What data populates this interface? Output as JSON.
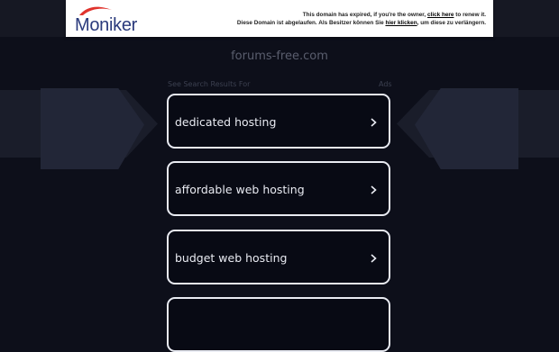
{
  "banner": {
    "logo_text": "Moniker",
    "line1_prefix": "This domain has expired, if you're the owner, ",
    "line1_link": "click here",
    "line1_suffix": " to renew it.",
    "line2_prefix": "Diese Domain ist abgelaufen. Als Besitzer können Sie ",
    "line2_link": "hier klicken",
    "line2_suffix": ", um diese zu verlängern."
  },
  "domain": "forums-free.com",
  "search_label": "See Search Results For",
  "ads_label": "Ads",
  "results": [
    {
      "label": "dedicated hosting"
    },
    {
      "label": "affordable web hosting"
    },
    {
      "label": "budget web hosting"
    },
    {
      "label": ""
    }
  ],
  "colors": {
    "background": "#0d0f1a",
    "card_border": "#e9ebf2",
    "logo_blue": "#2a3a7c",
    "logo_red": "#e0332d"
  },
  "icons": {
    "result_arrow": "chevron-right-icon",
    "logo_mark": "moniker-swoosh-icon"
  }
}
